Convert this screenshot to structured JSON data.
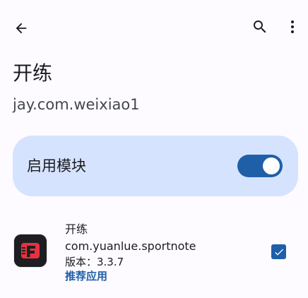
{
  "app_bar": {
    "back_icon": "arrow-back-icon",
    "search_icon": "search-icon",
    "more_icon": "more-vert-icon"
  },
  "header": {
    "title": "开练",
    "package": "jay.com.weixiao1"
  },
  "enable_card": {
    "label": "启用模块",
    "enabled": true,
    "accent": "#1f5fa8",
    "background": "#d6e3ff"
  },
  "scope_list": [
    {
      "name": "开练",
      "package": "com.yuanlue.sportnote",
      "version": "版本：3.3.7",
      "tag": "推荐应用",
      "checked": true,
      "icon": "sportnote-app-icon"
    }
  ]
}
